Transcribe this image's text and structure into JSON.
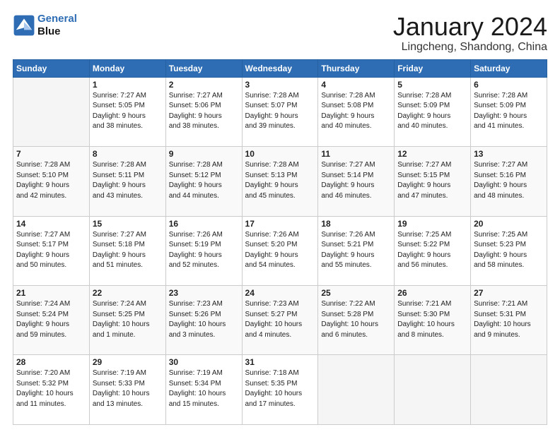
{
  "header": {
    "logo_line1": "General",
    "logo_line2": "Blue",
    "month": "January 2024",
    "location": "Lingcheng, Shandong, China"
  },
  "days_of_week": [
    "Sunday",
    "Monday",
    "Tuesday",
    "Wednesday",
    "Thursday",
    "Friday",
    "Saturday"
  ],
  "weeks": [
    [
      {
        "day": "",
        "info": ""
      },
      {
        "day": "1",
        "info": "Sunrise: 7:27 AM\nSunset: 5:05 PM\nDaylight: 9 hours\nand 38 minutes."
      },
      {
        "day": "2",
        "info": "Sunrise: 7:27 AM\nSunset: 5:06 PM\nDaylight: 9 hours\nand 38 minutes."
      },
      {
        "day": "3",
        "info": "Sunrise: 7:28 AM\nSunset: 5:07 PM\nDaylight: 9 hours\nand 39 minutes."
      },
      {
        "day": "4",
        "info": "Sunrise: 7:28 AM\nSunset: 5:08 PM\nDaylight: 9 hours\nand 40 minutes."
      },
      {
        "day": "5",
        "info": "Sunrise: 7:28 AM\nSunset: 5:09 PM\nDaylight: 9 hours\nand 40 minutes."
      },
      {
        "day": "6",
        "info": "Sunrise: 7:28 AM\nSunset: 5:09 PM\nDaylight: 9 hours\nand 41 minutes."
      }
    ],
    [
      {
        "day": "7",
        "info": "Sunrise: 7:28 AM\nSunset: 5:10 PM\nDaylight: 9 hours\nand 42 minutes."
      },
      {
        "day": "8",
        "info": "Sunrise: 7:28 AM\nSunset: 5:11 PM\nDaylight: 9 hours\nand 43 minutes."
      },
      {
        "day": "9",
        "info": "Sunrise: 7:28 AM\nSunset: 5:12 PM\nDaylight: 9 hours\nand 44 minutes."
      },
      {
        "day": "10",
        "info": "Sunrise: 7:28 AM\nSunset: 5:13 PM\nDaylight: 9 hours\nand 45 minutes."
      },
      {
        "day": "11",
        "info": "Sunrise: 7:27 AM\nSunset: 5:14 PM\nDaylight: 9 hours\nand 46 minutes."
      },
      {
        "day": "12",
        "info": "Sunrise: 7:27 AM\nSunset: 5:15 PM\nDaylight: 9 hours\nand 47 minutes."
      },
      {
        "day": "13",
        "info": "Sunrise: 7:27 AM\nSunset: 5:16 PM\nDaylight: 9 hours\nand 48 minutes."
      }
    ],
    [
      {
        "day": "14",
        "info": "Sunrise: 7:27 AM\nSunset: 5:17 PM\nDaylight: 9 hours\nand 50 minutes."
      },
      {
        "day": "15",
        "info": "Sunrise: 7:27 AM\nSunset: 5:18 PM\nDaylight: 9 hours\nand 51 minutes."
      },
      {
        "day": "16",
        "info": "Sunrise: 7:26 AM\nSunset: 5:19 PM\nDaylight: 9 hours\nand 52 minutes."
      },
      {
        "day": "17",
        "info": "Sunrise: 7:26 AM\nSunset: 5:20 PM\nDaylight: 9 hours\nand 54 minutes."
      },
      {
        "day": "18",
        "info": "Sunrise: 7:26 AM\nSunset: 5:21 PM\nDaylight: 9 hours\nand 55 minutes."
      },
      {
        "day": "19",
        "info": "Sunrise: 7:25 AM\nSunset: 5:22 PM\nDaylight: 9 hours\nand 56 minutes."
      },
      {
        "day": "20",
        "info": "Sunrise: 7:25 AM\nSunset: 5:23 PM\nDaylight: 9 hours\nand 58 minutes."
      }
    ],
    [
      {
        "day": "21",
        "info": "Sunrise: 7:24 AM\nSunset: 5:24 PM\nDaylight: 9 hours\nand 59 minutes."
      },
      {
        "day": "22",
        "info": "Sunrise: 7:24 AM\nSunset: 5:25 PM\nDaylight: 10 hours\nand 1 minute."
      },
      {
        "day": "23",
        "info": "Sunrise: 7:23 AM\nSunset: 5:26 PM\nDaylight: 10 hours\nand 3 minutes."
      },
      {
        "day": "24",
        "info": "Sunrise: 7:23 AM\nSunset: 5:27 PM\nDaylight: 10 hours\nand 4 minutes."
      },
      {
        "day": "25",
        "info": "Sunrise: 7:22 AM\nSunset: 5:28 PM\nDaylight: 10 hours\nand 6 minutes."
      },
      {
        "day": "26",
        "info": "Sunrise: 7:21 AM\nSunset: 5:30 PM\nDaylight: 10 hours\nand 8 minutes."
      },
      {
        "day": "27",
        "info": "Sunrise: 7:21 AM\nSunset: 5:31 PM\nDaylight: 10 hours\nand 9 minutes."
      }
    ],
    [
      {
        "day": "28",
        "info": "Sunrise: 7:20 AM\nSunset: 5:32 PM\nDaylight: 10 hours\nand 11 minutes."
      },
      {
        "day": "29",
        "info": "Sunrise: 7:19 AM\nSunset: 5:33 PM\nDaylight: 10 hours\nand 13 minutes."
      },
      {
        "day": "30",
        "info": "Sunrise: 7:19 AM\nSunset: 5:34 PM\nDaylight: 10 hours\nand 15 minutes."
      },
      {
        "day": "31",
        "info": "Sunrise: 7:18 AM\nSunset: 5:35 PM\nDaylight: 10 hours\nand 17 minutes."
      },
      {
        "day": "",
        "info": ""
      },
      {
        "day": "",
        "info": ""
      },
      {
        "day": "",
        "info": ""
      }
    ]
  ]
}
